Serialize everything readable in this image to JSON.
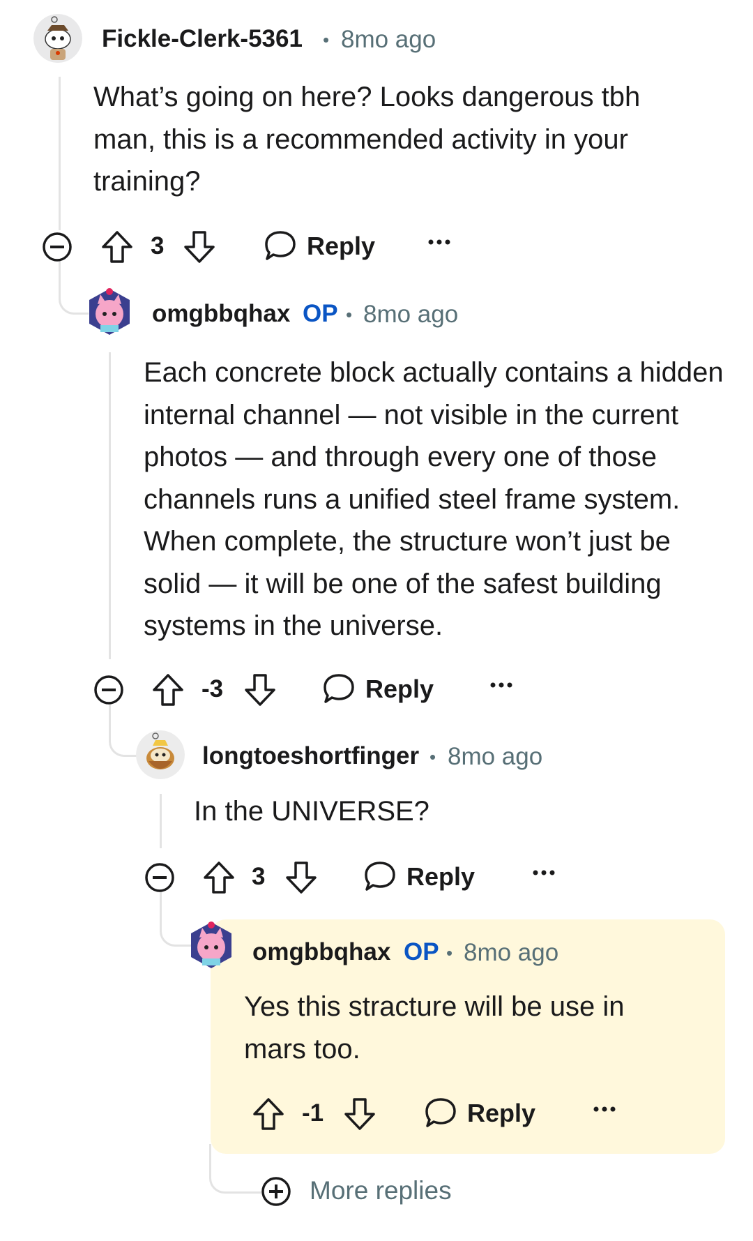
{
  "comments": [
    {
      "username": "Fickle-Clerk-5361",
      "op": "",
      "time": "8mo ago",
      "body": "What’s going on here? Looks dangerous tbh man, this is a recommended activity in your training?",
      "score": "3",
      "reply_label": "Reply",
      "avatar": "snoo-avatar"
    },
    {
      "username": "omgbbqhax",
      "op": "OP",
      "time": "8mo ago",
      "body": "Each concrete block actually contains a hidden internal channel — not visible in the current photos — and through every one of those channels runs a unified steel frame system. When complete, the structure won’t just be solid — it will be one of the safest building systems in the universe.",
      "score": "-3",
      "reply_label": "Reply",
      "avatar": "pink-cat-avatar"
    },
    {
      "username": "longtoeshortfinger",
      "op": "",
      "time": "8mo ago",
      "body": "In the UNIVERSE?",
      "score": "3",
      "reply_label": "Reply",
      "avatar": "golden-snoo-avatar"
    },
    {
      "username": "omgbbqhax",
      "op": "OP",
      "time": "8mo ago",
      "body": "Yes this stracture will be use in mars too.",
      "score": "-1",
      "reply_label": "Reply",
      "avatar": "pink-cat-avatar",
      "highlighted": true
    }
  ],
  "more_replies_label": "More replies",
  "colors": {
    "username": "#1a1a1b",
    "op_badge": "#0a55c4",
    "meta": "#576f76",
    "thread_line": "#e3e3e3",
    "highlight_bg": "#fff8dc"
  },
  "icons": [
    "collapse-icon",
    "upvote-icon",
    "downvote-icon",
    "reply-bubble-icon",
    "more-options-icon",
    "expand-plus-icon"
  ]
}
